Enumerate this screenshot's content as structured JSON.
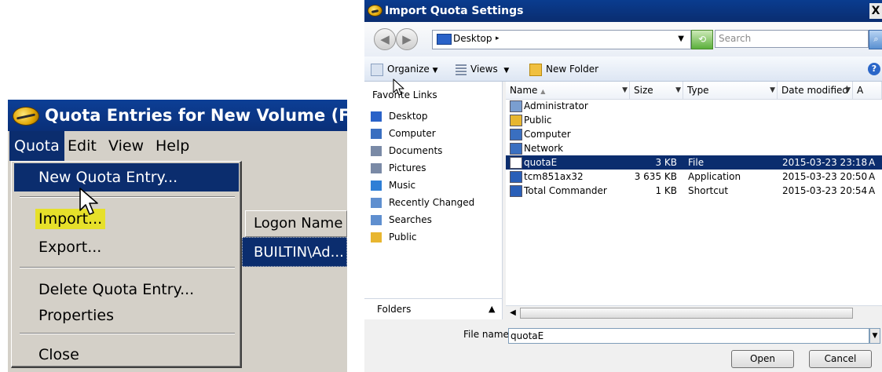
{
  "quota_window": {
    "title": "Quota Entries for New Volume (F:)",
    "menubar": [
      "Quota",
      "Edit",
      "View",
      "Help"
    ],
    "dropdown": {
      "items": [
        "New Quota Entry...",
        "Import...",
        "Export...",
        "Delete Quota Entry...",
        "Properties",
        "Close"
      ],
      "selected": "New Quota Entry...",
      "highlighted": "Import..."
    },
    "list": {
      "column_header": "Logon Name",
      "row": "BUILTIN\\Ad..."
    }
  },
  "dialog": {
    "title": "Import Quota Settings",
    "close_label": "X",
    "address": "Desktop",
    "search_placeholder": "Search",
    "toolbar": {
      "organize": "Organize",
      "views": "Views",
      "new_folder": "New Folder"
    },
    "favorite_links_title": "Favorite Links",
    "favorite_links": [
      {
        "label": "Desktop",
        "icon": "desktop-icon",
        "color": "#2a62c8"
      },
      {
        "label": "Computer",
        "icon": "computer-icon",
        "color": "#3a6fc0"
      },
      {
        "label": "Documents",
        "icon": "documents-icon",
        "color": "#7a8aa6"
      },
      {
        "label": "Pictures",
        "icon": "pictures-icon",
        "color": "#7a8aa6"
      },
      {
        "label": "Music",
        "icon": "music-icon",
        "color": "#2f7fd6"
      },
      {
        "label": "Recently Changed",
        "icon": "recently-changed-icon",
        "color": "#5f8fcf"
      },
      {
        "label": "Searches",
        "icon": "searches-icon",
        "color": "#5f8fcf"
      },
      {
        "label": "Public",
        "icon": "folder-icon",
        "color": "#e8b630"
      }
    ],
    "folders_label": "Folders",
    "columns": [
      "Name",
      "Size",
      "Type",
      "Date modified",
      "A"
    ],
    "files": [
      {
        "name": "Administrator",
        "size": "",
        "type": "",
        "date": "",
        "attr": "",
        "icon": "user-folder-icon",
        "color": "#7a9ed0"
      },
      {
        "name": "Public",
        "size": "",
        "type": "",
        "date": "",
        "attr": "",
        "icon": "folder-icon",
        "color": "#e8b630"
      },
      {
        "name": "Computer",
        "size": "",
        "type": "",
        "date": "",
        "attr": "",
        "icon": "computer-icon",
        "color": "#3a6fc0"
      },
      {
        "name": "Network",
        "size": "",
        "type": "",
        "date": "",
        "attr": "",
        "icon": "network-icon",
        "color": "#3a6fc0"
      },
      {
        "name": "quotaE",
        "size": "3 KB",
        "type": "File",
        "date": "2015-03-23 23:18",
        "attr": "A",
        "icon": "file-icon",
        "color": "#ffffff",
        "selected": true
      },
      {
        "name": "tcm851ax32",
        "size": "3 635 KB",
        "type": "Application",
        "date": "2015-03-23 20:50",
        "attr": "A",
        "icon": "application-icon",
        "color": "#2a5fb8"
      },
      {
        "name": "Total Commander",
        "size": "1 KB",
        "type": "Shortcut",
        "date": "2015-03-23 20:54",
        "attr": "A",
        "icon": "shortcut-icon",
        "color": "#2a5fb8"
      }
    ],
    "file_name_label": "File name:",
    "file_name_value": "quotaE",
    "open_button": "Open",
    "cancel_button": "Cancel"
  },
  "colors": {
    "selection": "#0b2d6e",
    "highlight": "#e6e02a",
    "titlebar": "#0a3c8f"
  }
}
